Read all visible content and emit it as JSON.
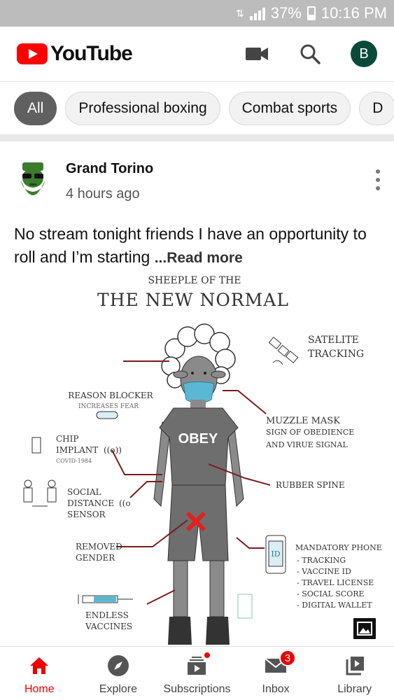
{
  "status_bar": {
    "battery": "37%",
    "time": "10:16 PM"
  },
  "header": {
    "logo_text": "YouTube",
    "avatar_letter": "B"
  },
  "chips": [
    "All",
    "Professional boxing",
    "Combat sports",
    "D"
  ],
  "post": {
    "channel": "Grand Torino",
    "time_ago": "4 hours ago",
    "text": "No stream tonight friends I have an opportunity to roll and I’m starting ",
    "read_more": "...Read more"
  },
  "image": {
    "top_cut": "SHEEPLE OF THE",
    "title": "THE NEW NORMAL",
    "labels": {
      "satelite": "SATELITE",
      "tracking": "TRACKING",
      "reason_blocker": "REASON BLOCKER",
      "increases_fear": "INCREASES FEAR",
      "chip": "CHIP",
      "implant": "IMPLANT",
      "covid": "COVID-1984",
      "muzzle_mask": "MUZZLE MASK",
      "muzzle_sub1": "SIGN OF OBEDIENCE",
      "muzzle_sub2": "AND VIRUE SIGNAL",
      "obey": "OBEY",
      "social": "SOCIAL",
      "distance": "DISTANCE",
      "sensor": "SENSOR",
      "rubber_spine": "RUBBER SPINE",
      "removed": "REMOVED",
      "gender": "GENDER",
      "mandatory_phone": "MANDATORY PHONE",
      "phone_id": "ID",
      "phone_items": [
        "- TRACKING",
        "- VACCINE ID",
        "- TRAVEL LICENSE",
        "- SOCIAL SCORE",
        "- DIGITAL WALLET"
      ],
      "endless": "ENDLESS",
      "vaccines": "VACCINES"
    }
  },
  "bottom_nav": {
    "home": "Home",
    "explore": "Explore",
    "subscriptions": "Subscriptions",
    "inbox": "Inbox",
    "inbox_badge": "3",
    "library": "Library"
  },
  "colors": {
    "brand": "#ff0000",
    "active_nav": "#ee0000",
    "avatar_bg": "#0b4a3a",
    "line": "#7a1d1d"
  }
}
